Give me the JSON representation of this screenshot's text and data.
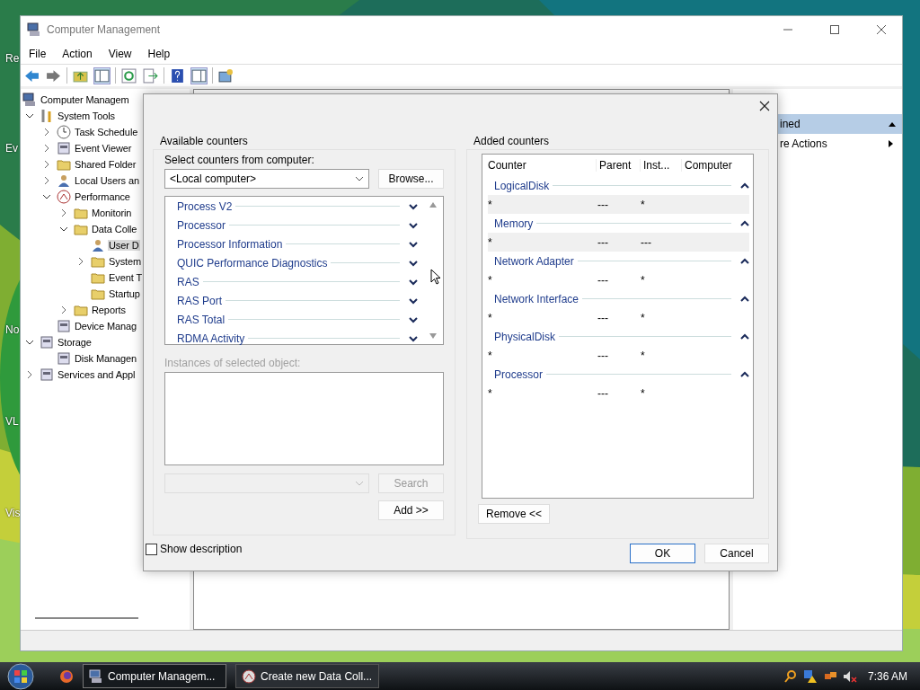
{
  "desktop_icons": [
    {
      "label": "Re"
    },
    {
      "label": "Ev"
    },
    {
      "label": "No"
    },
    {
      "label": "VL"
    },
    {
      "label": "Vis"
    }
  ],
  "window": {
    "title": "Computer Management"
  },
  "menu": [
    "File",
    "Action",
    "View",
    "Help"
  ],
  "tree": [
    {
      "label": "Computer Managem",
      "selected": false,
      "children": [
        {
          "label": "System Tools",
          "selected": false,
          "expanded": true,
          "children": [
            {
              "label": "Task Schedule",
              "selected": false,
              "expanded": false
            },
            {
              "label": "Event Viewer",
              "selected": false,
              "expanded": false
            },
            {
              "label": "Shared Folder",
              "selected": false,
              "expanded": false
            },
            {
              "label": "Local Users an",
              "selected": false,
              "expanded": false
            },
            {
              "label": "Performance",
              "selected": false,
              "expanded": true,
              "children": [
                {
                  "label": "Monitorin",
                  "selected": false,
                  "expanded": false
                },
                {
                  "label": "Data Colle",
                  "selected": false,
                  "expanded": true,
                  "children": [
                    {
                      "label": "User D",
                      "selected": true
                    },
                    {
                      "label": "System",
                      "selected": false,
                      "expanded": false
                    },
                    {
                      "label": "Event T",
                      "selected": false
                    },
                    {
                      "label": "Startup",
                      "selected": false
                    }
                  ]
                },
                {
                  "label": "Reports",
                  "selected": false,
                  "expanded": false
                }
              ]
            },
            {
              "label": "Device Manag",
              "selected": false
            }
          ]
        },
        {
          "label": "Storage",
          "selected": false,
          "expanded": true,
          "children": [
            {
              "label": "Disk Managen",
              "selected": false
            }
          ]
        },
        {
          "label": "Services and Appl",
          "selected": false,
          "expanded": false
        }
      ]
    }
  ],
  "actions": [
    {
      "label": "ined",
      "kind": "header"
    },
    {
      "label": "re Actions",
      "kind": "item"
    }
  ],
  "dialog": {
    "available_title": "Available counters",
    "computer_label": "Select counters from computer:",
    "computer_value": "<Local computer>",
    "browse": "Browse...",
    "available": [
      {
        "name": "Process V2",
        "expanded": false
      },
      {
        "name": "Processor",
        "expanded": false
      },
      {
        "name": "Processor Information",
        "expanded": false
      },
      {
        "name": "QUIC Performance Diagnostics",
        "expanded": false
      },
      {
        "name": "RAS",
        "expanded": false
      },
      {
        "name": "RAS Port",
        "expanded": false
      },
      {
        "name": "RAS Total",
        "expanded": false
      },
      {
        "name": "RDMA Activity",
        "expanded": false
      }
    ],
    "instances_label": "Instances of selected object:",
    "instances_disabled": true,
    "search": "Search",
    "search_disabled": true,
    "add": "Add >>",
    "show_description": {
      "label": "Show description",
      "checked": false
    },
    "added_title": "Added counters",
    "columns": [
      "Counter",
      "Parent",
      "Inst...",
      "Computer"
    ],
    "added": [
      {
        "name": "LogicalDisk",
        "expanded": true,
        "rows": [
          {
            "counter": "*",
            "parent": "---",
            "instance": "*",
            "selected": true
          }
        ]
      },
      {
        "name": "Memory",
        "expanded": true,
        "rows": [
          {
            "counter": "*",
            "parent": "---",
            "instance": "---",
            "selected": true
          }
        ]
      },
      {
        "name": "Network Adapter",
        "expanded": true,
        "rows": [
          {
            "counter": "*",
            "parent": "---",
            "instance": "*",
            "selected": false
          }
        ]
      },
      {
        "name": "Network Interface",
        "expanded": true,
        "rows": [
          {
            "counter": "*",
            "parent": "---",
            "instance": "*",
            "selected": false
          }
        ]
      },
      {
        "name": "PhysicalDisk",
        "expanded": true,
        "rows": [
          {
            "counter": "*",
            "parent": "---",
            "instance": "*",
            "selected": false
          }
        ]
      },
      {
        "name": "Processor",
        "expanded": true,
        "rows": [
          {
            "counter": "*",
            "parent": "---",
            "instance": "*",
            "selected": false
          }
        ]
      }
    ],
    "remove": "Remove <<",
    "ok": "OK",
    "cancel": "Cancel"
  },
  "taskbar": {
    "tasks": [
      {
        "label": "Computer Managem...",
        "selected": true
      },
      {
        "label": "Create new Data Coll...",
        "selected": false
      }
    ],
    "clock": "7:36 AM"
  }
}
